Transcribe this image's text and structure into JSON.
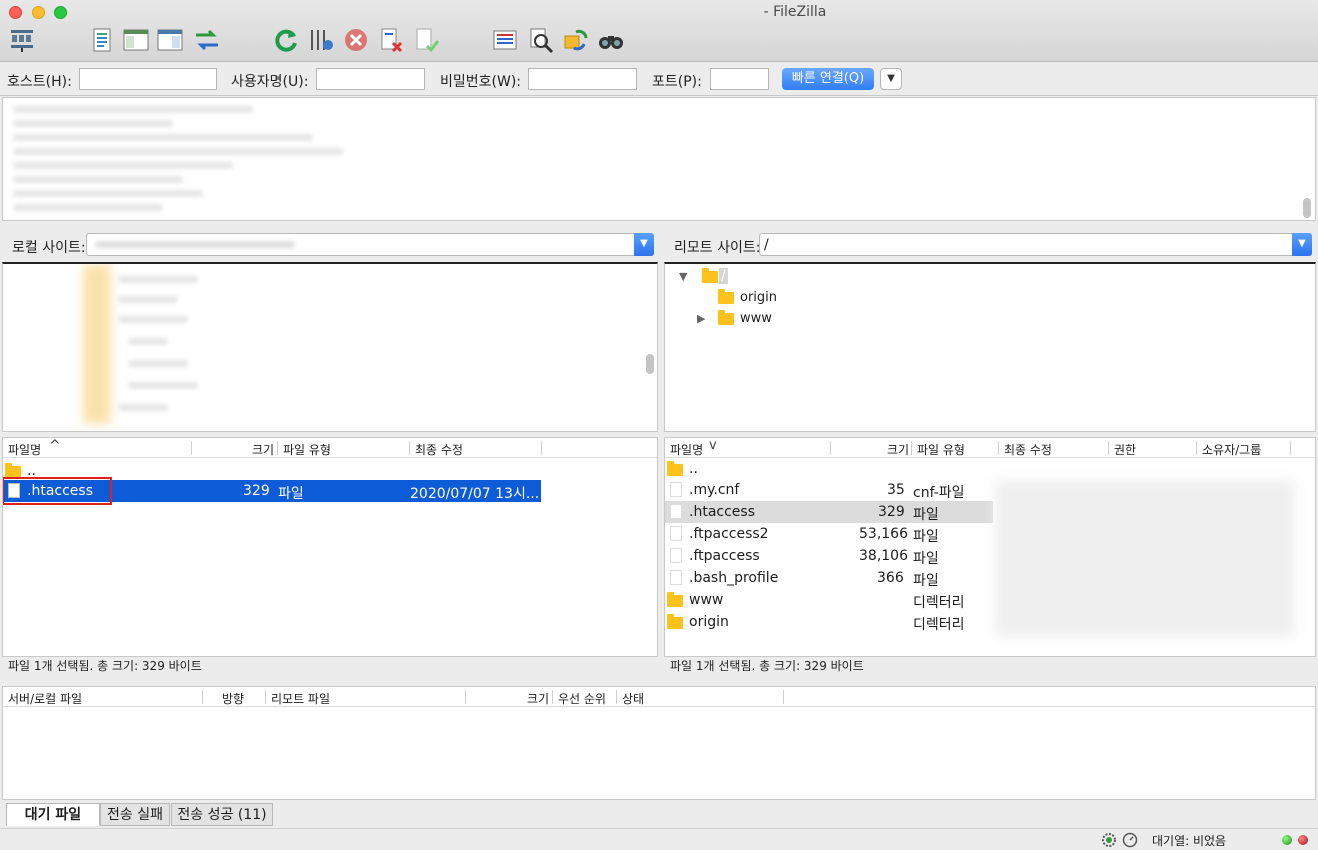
{
  "window": {
    "title": "- FileZilla"
  },
  "toolbar": {
    "icons": [
      "site-manager-icon",
      "message-log-icon",
      "local-tree-icon",
      "remote-tree-icon",
      "transfer-queue-icon",
      "refresh-icon",
      "process-queue-icon",
      "cancel-icon",
      "disconnect-icon",
      "reconnect-icon",
      "filelist-filter-icon",
      "compare-icon",
      "sync-browse-icon",
      "search-icon"
    ]
  },
  "quickconnect": {
    "host_label": "호스트(H):",
    "user_label": "사용자명(U):",
    "pass_label": "비밀번호(W):",
    "port_label": "포트(P):",
    "host_value": "",
    "user_value": "",
    "pass_value": "",
    "port_value": "",
    "connect_label": "빠른 연결(Q)",
    "dropdown_glyph": "▼"
  },
  "local": {
    "site_label": "로컬 사이트:",
    "path": "",
    "columns": [
      "파일명",
      "크기",
      "파일 유형",
      "최종 수정"
    ],
    "sort_glyph": "^",
    "rows": [
      {
        "name": "..",
        "size": "",
        "type": "",
        "modified": "",
        "kind": "folder"
      },
      {
        "name": ".htaccess",
        "size": "329",
        "type": "파일",
        "modified": "2020/07/07 13시...",
        "kind": "file",
        "selected": true
      }
    ],
    "status": "파일 1개 선택됨. 총 크기: 329 바이트"
  },
  "remote": {
    "site_label": "리모트 사이트:",
    "path": "/",
    "tree": [
      {
        "label": "/",
        "expander": "▼"
      },
      {
        "label": "origin",
        "expander": ""
      },
      {
        "label": "www",
        "expander": "▶"
      }
    ],
    "columns": [
      "파일명",
      "크기",
      "파일 유형",
      "최종 수정",
      "권한",
      "소유자/그룹"
    ],
    "sort_glyph": "v",
    "rows": [
      {
        "name": "..",
        "size": "",
        "type": "",
        "kind": "folder"
      },
      {
        "name": ".my.cnf",
        "size": "35",
        "type": "cnf-파일",
        "kind": "file"
      },
      {
        "name": ".htaccess",
        "size": "329",
        "type": "파일",
        "kind": "file",
        "selected": true
      },
      {
        "name": ".ftpaccess2",
        "size": "53,166",
        "type": "파일",
        "kind": "file"
      },
      {
        "name": ".ftpaccess",
        "size": "38,106",
        "type": "파일",
        "kind": "file"
      },
      {
        "name": ".bash_profile",
        "size": "366",
        "type": "파일",
        "kind": "file"
      },
      {
        "name": "www",
        "size": "",
        "type": "디렉터리",
        "kind": "folder"
      },
      {
        "name": "origin",
        "size": "",
        "type": "디렉터리",
        "kind": "folder"
      }
    ],
    "status": "파일 1개 선택됨. 총 크기: 329 바이트"
  },
  "queue": {
    "columns": [
      "서버/로컬 파일",
      "방향",
      "리모트 파일",
      "크기",
      "우선 순위",
      "상태"
    ],
    "tabs": [
      "대기 파일",
      "전송 실패",
      "전송 성공 (11)"
    ]
  },
  "statusbar": {
    "queue_text": "대기열: 비었음"
  },
  "colors": {
    "selection": "#0e5bd8",
    "accent": "#2f7ef5",
    "highlight_box": "#e0201b",
    "folder": "#ffc21a"
  }
}
